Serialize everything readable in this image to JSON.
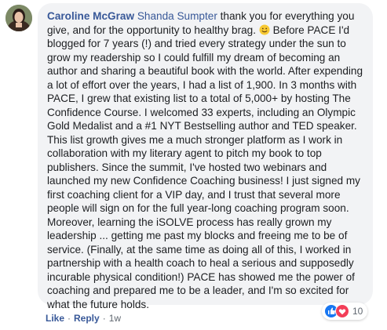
{
  "comment": {
    "author": "Caroline McGraw",
    "tagged": "Shanda Sumpter",
    "text_before_emoji": " thank you for everything you give, and for the opportunity to healthy brag. ",
    "emoji": "smile-emoji",
    "text_after_emoji": " Before PACE I'd blogged for 7 years (!) and tried every strategy under the sun to grow my readership so I could fulfill my dream of becoming an author and sharing a beautiful book with the world. After expending a lot of effort over the years, I had a list of 1,900. In 3 months with PACE, I grew that existing list to a total of 5,000+ by hosting The Confidence Course. I welcomed 33 experts, including an Olympic Gold Medalist and a #1 NYT Bestselling author and TED speaker. This list growth gives me a much stronger platform as I work in collaboration with my literary agent to pitch my book to top publishers. Since the summit, I've hosted two webinars and launched my new Confidence Coaching business! I just signed my first coaching client for a VIP day, and I trust that several more people will sign on for the full year-long coaching program soon. Moreover, learning the iSOLVE process has really grown my leadership ... getting me past my blocks and freeing me to be of service. (Finally, at the same time as doing all of this, I worked in partnership with a health coach to heal a serious and supposedly incurable physical condition!) PACE has showed me the power of coaching and prepared me to be a leader, and I'm so excited for what the future holds."
  },
  "actions": {
    "like": "Like",
    "separator": "·",
    "reply": "Reply",
    "time": "1w"
  },
  "reactions": {
    "icons": [
      "like-reaction-icon",
      "love-reaction-icon"
    ],
    "count": "10"
  },
  "colors": {
    "link": "#385898",
    "bubble": "#f2f3f5",
    "like": "#1877f2",
    "love": "#f33e58"
  }
}
